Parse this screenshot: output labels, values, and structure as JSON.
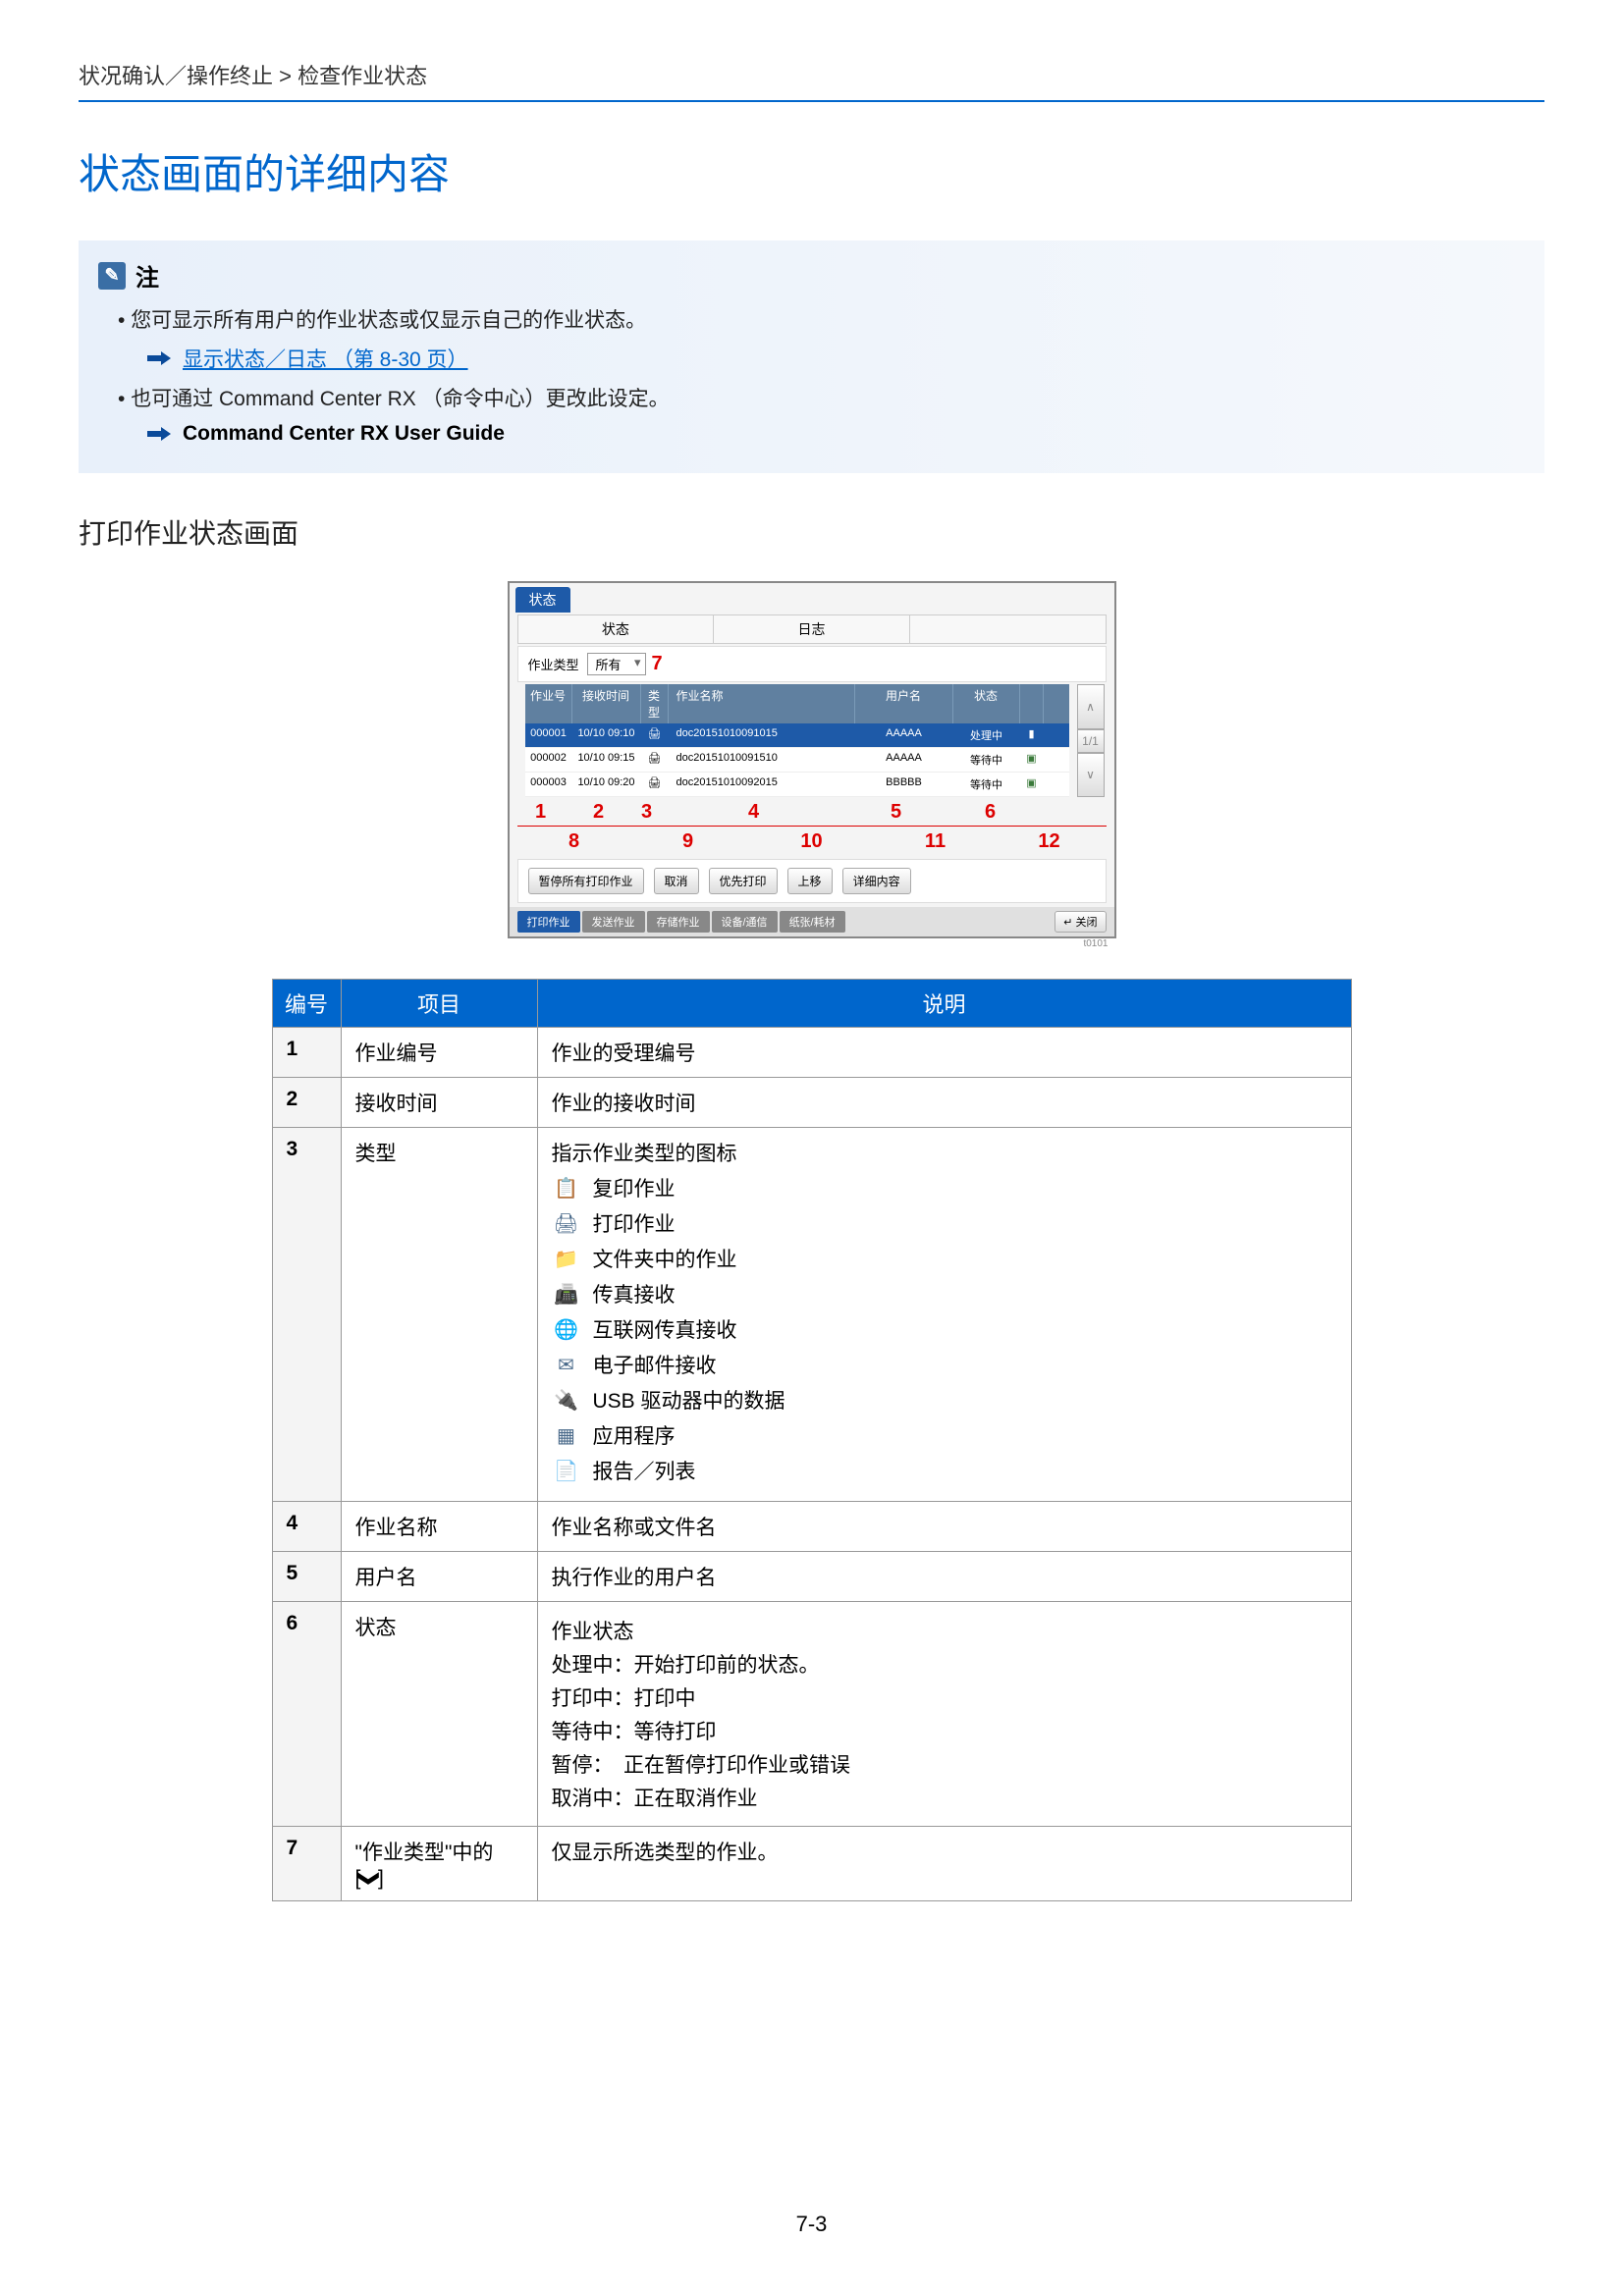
{
  "breadcrumb": "状况确认／操作终止 > 检查作业状态",
  "page_title": "状态画面的详细内容",
  "note": {
    "label": "注",
    "items": {
      "line1": "您可显示所有用户的作业状态或仅显示自己的作业状态。",
      "link1": "显示状态／日志 （第 8-30 页）",
      "line2": "也可通过 Command Center RX （命令中心）更改此设定。",
      "ref2": "Command Center RX User Guide"
    }
  },
  "section_title": "打印作业状态画面",
  "screen": {
    "title_tab": "状态",
    "tab_status": "状态",
    "tab_log": "日志",
    "jobtype_label": "作业类型",
    "jobtype_value": "所有",
    "inline_marker": "7",
    "headers": {
      "no": "作业号",
      "time": "接收时间",
      "type": "类型",
      "name": "作业名称",
      "user": "用户名",
      "status": "状态"
    },
    "rows": [
      {
        "no": "000001",
        "time": "10/10 09:10",
        "name": "doc20151010091015",
        "user": "AAAAA",
        "status": "处理中",
        "sel": true
      },
      {
        "no": "000002",
        "time": "10/10 09:15",
        "name": "doc20151010091510",
        "user": "AAAAA",
        "status": "等待中",
        "sel": false
      },
      {
        "no": "000003",
        "time": "10/10 09:20",
        "name": "doc20151010092015",
        "user": "BBBBB",
        "status": "等待中",
        "sel": false
      }
    ],
    "page_indicator": "1/1",
    "markers_row1": [
      "1",
      "2",
      "3",
      "4",
      "5",
      "6"
    ],
    "markers_row2": [
      "8",
      "9",
      "10",
      "11",
      "12"
    ],
    "btns": {
      "pause": "暂停所有打印作业",
      "cancel": "取消",
      "priority": "优先打印",
      "moveup": "上移",
      "detail": "详细内容"
    },
    "bottom_tabs": {
      "print": "打印作业",
      "send": "发送作业",
      "store": "存储作业",
      "device": "设备/通信",
      "paper": "纸张/耗材"
    },
    "close": "关闭",
    "tcode": "t0101"
  },
  "table": {
    "head_no": "编号",
    "head_item": "项目",
    "head_desc": "说明",
    "rows": {
      "r1": {
        "no": "1",
        "item": "作业编号",
        "desc": "作业的受理编号"
      },
      "r2": {
        "no": "2",
        "item": "接收时间",
        "desc": "作业的接收时间"
      },
      "r3": {
        "no": "3",
        "item": "类型",
        "desc_head": "指示作业类型的图标",
        "types": {
          "copy": "复印作业",
          "print": "打印作业",
          "folder": "文件夹中的作业",
          "fax": "传真接收",
          "ifax": "互联网传真接收",
          "email": "电子邮件接收",
          "usb": "USB 驱动器中的数据",
          "app": "应用程序",
          "report": "报告／列表"
        }
      },
      "r4": {
        "no": "4",
        "item": "作业名称",
        "desc": "作业名称或文件名"
      },
      "r5": {
        "no": "5",
        "item": "用户名",
        "desc": "执行作业的用户名"
      },
      "r6": {
        "no": "6",
        "item": "状态",
        "lines": {
          "l1": "作业状态",
          "l2": "处理中：开始打印前的状态。",
          "l3": "打印中：打印中",
          "l4": "等待中：等待打印",
          "l5": "暂停：　正在暂停打印作业或错误",
          "l6": "取消中：正在取消作业"
        }
      },
      "r7": {
        "no": "7",
        "item_line1": "\"作业类型\"中的",
        "item_line2_prefix": "[",
        "item_line2_suffix": "]",
        "desc": "仅显示所选类型的作业。"
      }
    }
  },
  "page_num": "7-3"
}
